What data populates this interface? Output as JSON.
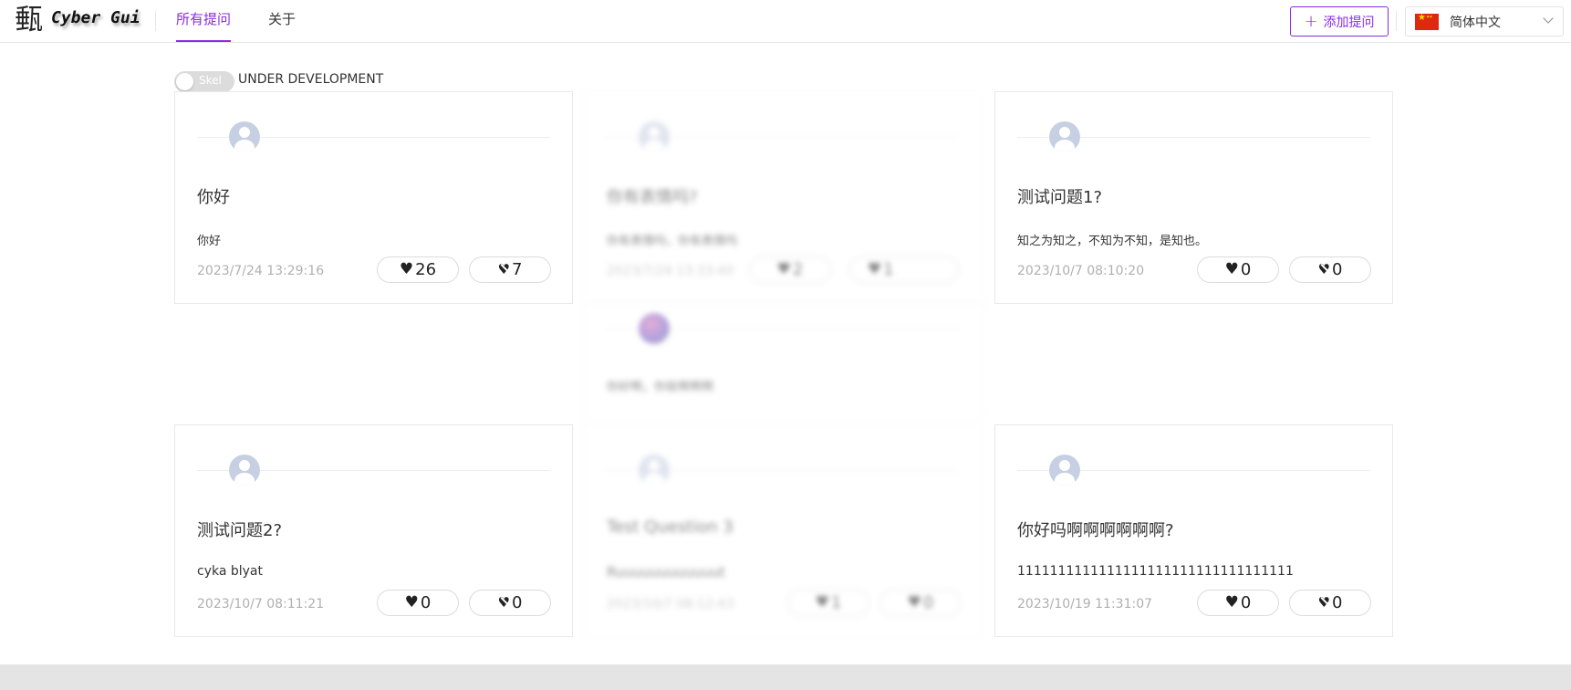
{
  "header": {
    "logo_glyph": "甀",
    "logo_text": "Cyber Gui",
    "tabs": [
      {
        "label": "所有提问",
        "active": true
      },
      {
        "label": "关于",
        "active": false
      }
    ],
    "add_button_label": "添加提问",
    "language": {
      "selected": "简体中文",
      "flag": "china-flag-icon"
    }
  },
  "skeleton_toggle": {
    "label": "Skel",
    "on": false
  },
  "dev_notice": "UNDER DEVELOPMENT",
  "colors": {
    "accent": "#8a2be2",
    "border": "#e8e8e8",
    "muted": "#b0b0b0"
  },
  "cards": [
    {
      "title": "你好",
      "content": "你好",
      "date": "2023/7/24 13:29:16",
      "likes": "26",
      "dislikes": "7"
    },
    {
      "title": "你有表情吗?",
      "content": "你有表情吗，你有表情吗",
      "date": "2023/7/24 13:33:40",
      "likes": "2",
      "dislikes": "1         "
    },
    {
      "title": "测试问题1?",
      "content": "知之为知之，不知为不知，是知也。",
      "date": "2023/10/7 08:10:20",
      "likes": "0",
      "dislikes": "0"
    },
    {
      "title": "",
      "content": "你好啊，你就啊啊啊",
      "date": "",
      "likes": "",
      "dislikes": ""
    },
    {
      "title": "测试问题2?",
      "content": "cyka blyat",
      "date": "2023/10/7 08:11:21",
      "likes": "0",
      "dislikes": "0"
    },
    {
      "title": "Test Question 3",
      "content": "Ruuuuuuuuuuuut",
      "date": "2023/10/7 08:12:43",
      "likes": "1",
      "dislikes": "0"
    },
    {
      "title": "你好吗啊啊啊啊啊啊?",
      "content": "1111111111111111111111111111111111",
      "date": "2023/10/19 11:31:07",
      "likes": "0",
      "dislikes": "0"
    }
  ]
}
